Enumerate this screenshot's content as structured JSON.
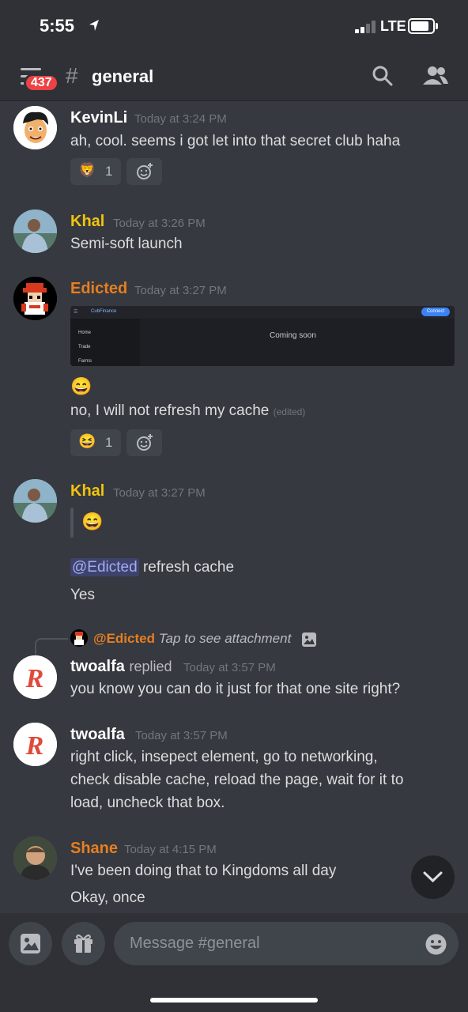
{
  "status_bar": {
    "time": "5:55",
    "network": "LTE",
    "icons": [
      "location-arrow-icon",
      "signal-icon",
      "battery-icon"
    ]
  },
  "header": {
    "unread_badge": "437",
    "hash": "#",
    "channel": "general",
    "icons": [
      "hamburger-icon",
      "search-icon",
      "members-icon"
    ]
  },
  "messages": [
    {
      "author": "KevinLi",
      "author_color": "#ffffff",
      "timestamp": "Today at 3:24 PM",
      "lines": [
        "ah, cool. seems i got let into that secret club haha"
      ],
      "reaction": {
        "emoji": "🦁",
        "count": "1"
      }
    },
    {
      "author": "Khal",
      "author_color": "#f1c40f",
      "timestamp": "Today at 3:26 PM",
      "lines": [
        "Semi-soft launch"
      ]
    },
    {
      "author": "Edicted",
      "author_color": "#e67e22",
      "timestamp": "Today at 3:27 PM",
      "embed": {
        "logo": "CubFinance",
        "connect": "Connect",
        "nav": [
          "Home",
          "Trade",
          "Farms"
        ],
        "center_text": "Coming soon"
      },
      "emoji_line": "😄",
      "text": "no, I will not refresh my cache",
      "edited": "(edited)",
      "reaction": {
        "emoji": "😆",
        "count": "1"
      }
    },
    {
      "author": "Khal",
      "author_color": "#f1c40f",
      "timestamp": "Today at 3:27 PM",
      "quote_emoji": "😄",
      "mention": "@Edicted",
      "mention_text": "refresh cache",
      "line2": "Yes"
    },
    {
      "reply_to": {
        "mention": "@Edicted",
        "text": "Tap to see attachment"
      },
      "author": "twoalfa",
      "author_color": "#ffffff",
      "replied": "replied",
      "timestamp": "Today at 3:57 PM",
      "lines": [
        "you know you can do it just for that one site right?"
      ]
    },
    {
      "author": "twoalfa",
      "author_color": "#ffffff",
      "timestamp": "Today at 3:57 PM",
      "lines": [
        "right click, insepect element,  go to networking,",
        "check disable cache, reload the page, wait for it to",
        "load, uncheck that box."
      ]
    },
    {
      "author": "Shane",
      "author_color": "#e67e22",
      "timestamp": "Today at 4:15 PM",
      "lines": [
        "I've been doing that to Kingdoms all day",
        "Okay, once"
      ]
    }
  ],
  "composer": {
    "placeholder": "Message #general",
    "icons": [
      "image-icon",
      "gift-icon",
      "emoji-icon"
    ]
  },
  "colors": {
    "background": "#36393f",
    "header": "#2f3136",
    "badge": "#ed4245",
    "mention": "#a3acf2"
  }
}
